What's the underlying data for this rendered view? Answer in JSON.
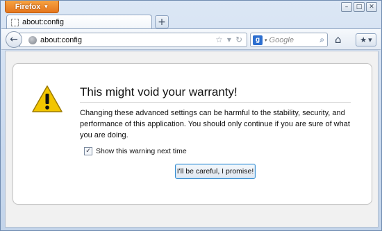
{
  "window": {
    "app_button_label": "Firefox",
    "app_button_arrow": "▼",
    "controls": [
      "–",
      "□",
      "✕"
    ]
  },
  "tabs": [
    {
      "label": "about:config",
      "icon": "page-icon"
    }
  ],
  "new_tab_label": "+",
  "navbar": {
    "back_icon": "←",
    "url": "about:config",
    "star_icon": "☆",
    "dropdown_icon": "▾",
    "reload_icon": "↻",
    "search_engine_letter": "g",
    "search_placeholder": "Google",
    "search_icon": "⌕",
    "home_icon": "⌂",
    "bookmarks_icon": "★"
  },
  "warning": {
    "title": "This might void your warranty!",
    "body": "Changing these advanced settings can be harmful to the stability, security, and performance of this application. You should only continue if you are sure of what you are doing.",
    "checkbox_label": "Show this warning next time",
    "checkbox_checked": true,
    "checkbox_mark": "✓",
    "button_label": "I'll be careful, I promise!"
  },
  "colors": {
    "firefox_button": "#e6761d",
    "warning_icon": "#f2c500",
    "focus_border": "#3a8fd0"
  }
}
